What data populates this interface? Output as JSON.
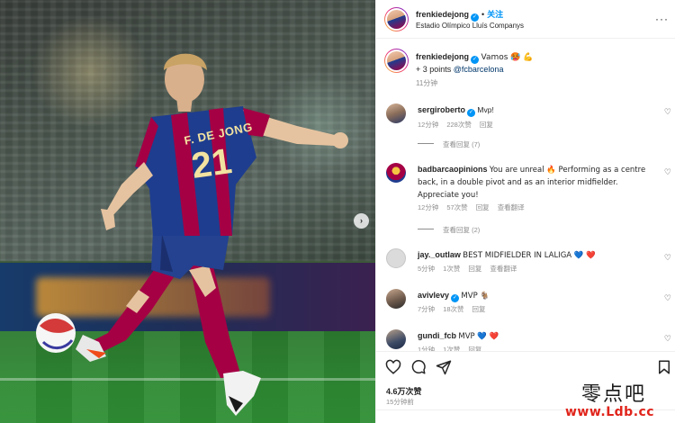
{
  "post": {
    "author": "frenkiedejong",
    "follow_label": "关注",
    "location": "Estadio Olímpico Lluís Companys",
    "caption": {
      "text": "Vamos 🥵 💪",
      "line2_prefix": "+ 3 points ",
      "mention": "@fcbarcelona",
      "time": "11分钟"
    },
    "likes": "4.6万次赞",
    "posted": "15分钟前",
    "jersey": {
      "name": "F. DE JONG",
      "number": "21"
    }
  },
  "comments": [
    {
      "user": "sergiroberto",
      "verified": true,
      "text": "Mvp!",
      "time": "12分钟",
      "likes": "228次赞",
      "reply": "回复",
      "view_replies": "查看回复 (7)"
    },
    {
      "user": "badbarcaopinions",
      "verified": false,
      "text": "You are unreal 🔥 Performing as a centre back, in a double pivot and as an interior midfielder. Appreciate you!",
      "time": "12分钟",
      "likes": "57次赞",
      "reply": "回复",
      "translate": "查看翻译",
      "view_replies": "查看回复 (2)"
    },
    {
      "user": "jay._outlaw",
      "verified": false,
      "text": "BEST MIDFIELDER IN LALIGA 💙 ❤️",
      "time": "5分钟",
      "likes": "1次赞",
      "reply": "回复",
      "translate": "查看翻译"
    },
    {
      "user": "avivlevy",
      "verified": true,
      "text": "MVP 🐐",
      "time": "7分钟",
      "likes": "18次赞",
      "reply": "回复"
    },
    {
      "user": "gundi_fcb",
      "verified": false,
      "text": "MVP 💙 ❤️",
      "time": "1分钟",
      "likes": "1次赞",
      "reply": "回复"
    }
  ],
  "watermark": {
    "cn": "零点吧",
    "url": "www.Ldb.cc"
  },
  "icons": {
    "more": "more-horizontal-icon",
    "like": "heart-outline-icon",
    "comment": "comment-bubble-icon",
    "share": "paper-plane-icon",
    "save": "bookmark-icon",
    "next": "chevron-right-icon"
  },
  "colors": {
    "link_blue": "#0095f6",
    "mention": "#00376b",
    "secondary_text": "#8e8e8e",
    "barca_blue": "#1e3d8f",
    "barca_red": "#a50044"
  }
}
